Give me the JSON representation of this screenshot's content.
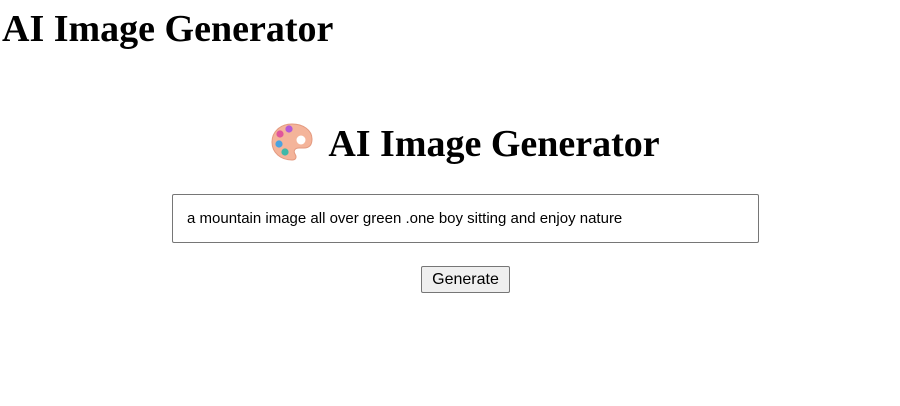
{
  "page": {
    "title": "AI Image Generator"
  },
  "app": {
    "heading": "AI Image Generator",
    "icon": "artist-palette-icon"
  },
  "prompt": {
    "value": "a mountain image all over green .one boy sitting and enjoy nature",
    "placeholder": ""
  },
  "actions": {
    "generate_label": "Generate"
  },
  "colors": {
    "palette_body": "#f4b49a",
    "input_border": "#767676",
    "button_bg": "#efefef"
  }
}
